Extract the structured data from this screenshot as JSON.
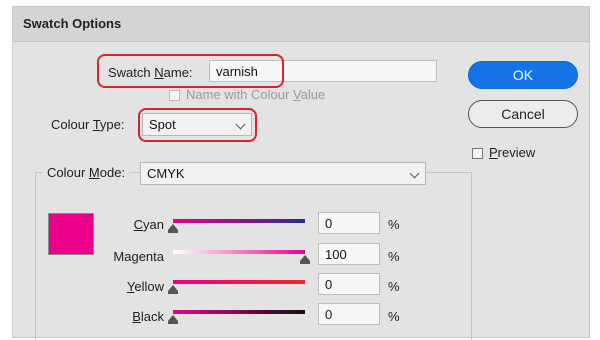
{
  "dialog": {
    "title": "Swatch Options",
    "swatch_name": {
      "label_before": "Swatch ",
      "label_underlined": "N",
      "label_after": "ame:",
      "value": "varnish"
    },
    "name_with_colour_value": {
      "label_before": "Name with Colour ",
      "label_underlined": "V",
      "label_after": "alue",
      "checked": false
    },
    "colour_type": {
      "label_before": "Colour ",
      "label_underlined": "T",
      "label_after": "ype:",
      "value": "Spot"
    },
    "colour_mode": {
      "label_before": "Colour ",
      "label_underlined": "M",
      "label_after": "ode:",
      "value": "CMYK"
    },
    "buttons": {
      "ok": "OK",
      "cancel": "Cancel"
    },
    "preview": {
      "label_underlined": "P",
      "label_after": "review",
      "checked": false
    },
    "swatch_color": "#ea0089",
    "channels": {
      "cyan": {
        "underlined": "C",
        "rest": "yan",
        "value": "0",
        "unit": "%",
        "gradient_from": "#ea0089",
        "gradient_to": "#2b2a8c"
      },
      "magenta": {
        "before": "Ma",
        "underlined": "g",
        "after": "enta",
        "value": "100",
        "unit": "%",
        "gradient_from": "#ffffff",
        "gradient_to": "#ea0089"
      },
      "yellow": {
        "underlined": "Y",
        "rest": "ellow",
        "value": "0",
        "unit": "%",
        "gradient_from": "#ea0089",
        "gradient_to": "#f0282a"
      },
      "black": {
        "underlined": "B",
        "rest": "lack",
        "value": "0",
        "unit": "%",
        "gradient_from": "#ea0089",
        "gradient_to": "#111111"
      }
    },
    "highlight_color": "#d6252c",
    "accent_color": "#1473e6"
  }
}
